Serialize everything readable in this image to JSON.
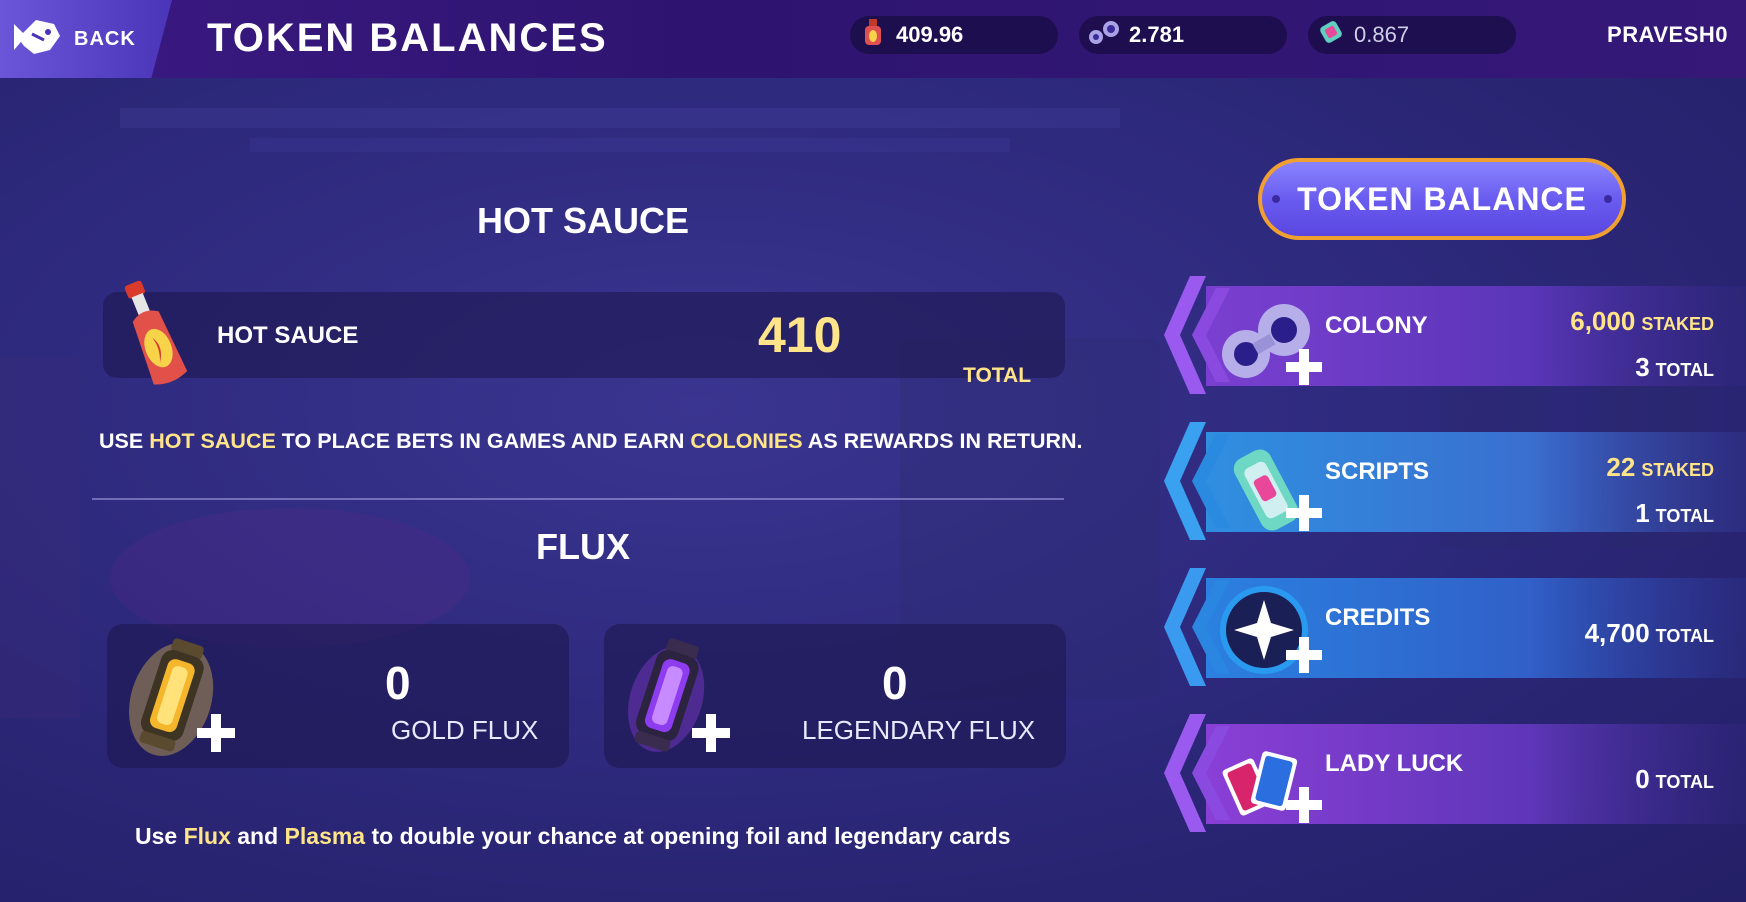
{
  "header": {
    "back_label": "BACK",
    "title": "TOKEN BALANCES",
    "balances": [
      {
        "icon": "hot-sauce-icon",
        "value": "409.96"
      },
      {
        "icon": "colony-icon",
        "value": "2.781"
      },
      {
        "icon": "script-icon",
        "value": "0.867"
      }
    ],
    "username": "PRAVESH0"
  },
  "hot_sauce": {
    "heading": "HOT SAUCE",
    "name": "HOT SAUCE",
    "amount": "410",
    "total_label": "TOTAL",
    "description": {
      "p1": "USE ",
      "h1": "HOT SAUCE",
      "p2": " TO PLACE BETS IN GAMES AND EARN ",
      "h2": "COLONIES",
      "p3": " AS REWARDS IN RETURN."
    }
  },
  "flux": {
    "heading": "FLUX",
    "cards": [
      {
        "value": "0",
        "label": "GOLD FLUX"
      },
      {
        "value": "0",
        "label": "LEGENDARY FLUX"
      }
    ],
    "footer": {
      "p1": "Use ",
      "h1": "Flux",
      "p2": " and ",
      "h2": "Plasma",
      "p3": " to double your chance at opening foil and legendary cards"
    }
  },
  "token_balance": {
    "button_label": "TOKEN BALANCE",
    "items": [
      {
        "name": "COLONY",
        "staked": "6,000",
        "staked_label": "STAKED",
        "total": "3",
        "total_label": "TOTAL"
      },
      {
        "name": "SCRIPTS",
        "staked": "22",
        "staked_label": "STAKED",
        "total": "1",
        "total_label": "TOTAL"
      },
      {
        "name": "CREDITS",
        "total": "4,700",
        "total_label": "TOTAL"
      },
      {
        "name": "LADY LUCK",
        "total": "0",
        "total_label": "TOTAL"
      }
    ]
  },
  "colors": {
    "highlight": "#ffe48a",
    "colony_band": "#7a3fd0",
    "scripts_band": "#2f8fe0",
    "credits_band": "#2b6fd6",
    "lady_luck_band": "#8a3fd6"
  }
}
